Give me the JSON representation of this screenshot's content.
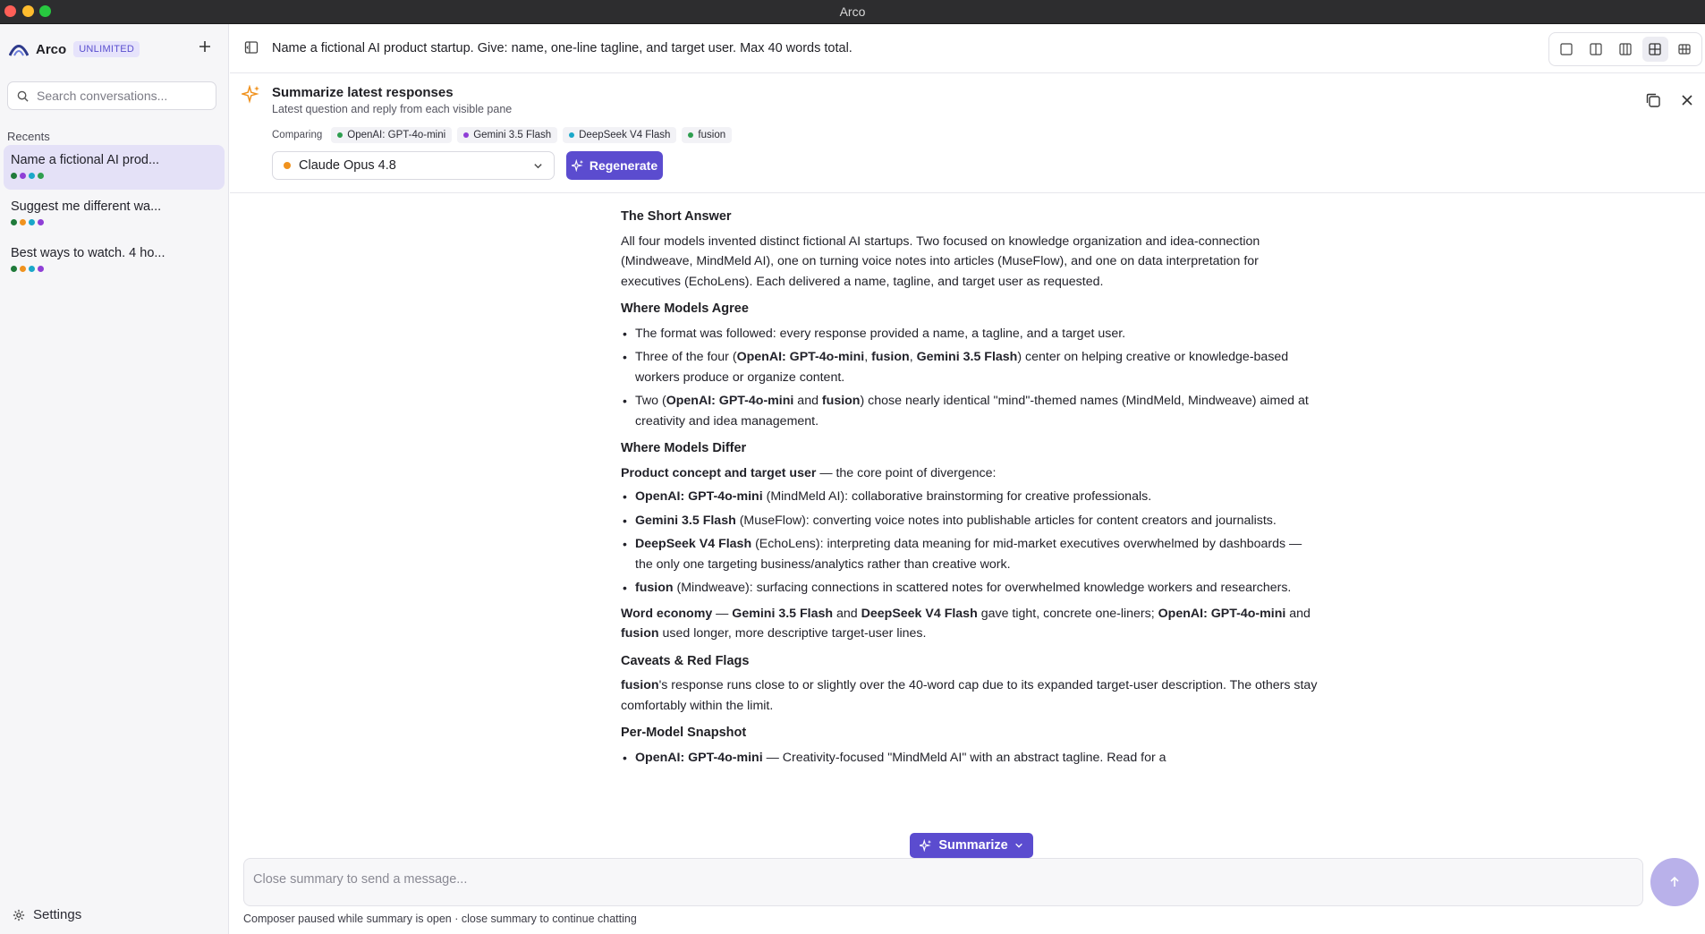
{
  "window": {
    "title": "Arco"
  },
  "sidebar": {
    "brand": "Arco",
    "badge": "UNLIMITED",
    "search_placeholder": "Search conversations...",
    "recents_label": "Recents",
    "conversations": [
      {
        "title": "Name a fictional AI prod...",
        "dots": [
          "#1f7a3a",
          "#8f3fd6",
          "#1aa7c9",
          "#2e9e4f"
        ]
      },
      {
        "title": "Suggest me different wa...",
        "dots": [
          "#1f7a3a",
          "#f0921e",
          "#1aa7c9",
          "#8f3fd6"
        ]
      },
      {
        "title": "Best ways to watch. 4 ho...",
        "dots": [
          "#1f7a3a",
          "#f0921e",
          "#1aa7c9",
          "#8f3fd6"
        ]
      }
    ],
    "settings_label": "Settings"
  },
  "header": {
    "question": "Name a fictional AI product startup. Give: name, one-line tagline, and target user. Max 40 words total."
  },
  "summary": {
    "title": "Summarize latest responses",
    "subtitle": "Latest question and reply from each visible pane",
    "comparing_label": "Comparing",
    "chips": [
      {
        "label": "OpenAI: GPT-4o-mini",
        "color": "#2e9e4f"
      },
      {
        "label": "Gemini 3.5 Flash",
        "color": "#8f3fd6"
      },
      {
        "label": "DeepSeek V4 Flash",
        "color": "#1aa7c9"
      },
      {
        "label": "fusion",
        "color": "#2e9e4f"
      }
    ],
    "model": "Claude Opus 4.8",
    "model_color": "#f0921e",
    "regenerate_label": "Regenerate"
  },
  "article": {
    "h_short": "The Short Answer",
    "short_p": "All four models invented distinct fictional AI startups. Two focused on knowledge organization and idea-connection (Mindweave, MindMeld AI), one on turning voice notes into articles (MuseFlow), and one on data interpretation for executives (EchoLens). Each delivered a name, tagline, and target user as requested.",
    "h_agree": "Where Models Agree",
    "agree1": "The format was followed: every response provided a name, a tagline, and a target user.",
    "agree2_a": "Three of the four (",
    "agree2_b1": "OpenAI: GPT-4o-mini",
    "agree2_c1": ", ",
    "agree2_b2": "fusion",
    "agree2_c2": ", ",
    "agree2_b3": "Gemini 3.5 Flash",
    "agree2_d": ") center on helping creative or knowledge-based workers produce or organize content.",
    "agree3_a": "Two (",
    "agree3_b1": "OpenAI: GPT-4o-mini",
    "agree3_c": " and ",
    "agree3_b2": "fusion",
    "agree3_d": ") chose nearly identical \"mind\"-themed names (MindMeld, Mindweave) aimed at creativity and idea management.",
    "h_differ": "Where Models Differ",
    "differ_lead_b": "Product concept and target user",
    "differ_lead_t": " — the core point of divergence:",
    "differ1_b": "OpenAI: GPT-4o-mini",
    "differ1_t": " (MindMeld AI): collaborative brainstorming for creative professionals.",
    "differ2_b": "Gemini 3.5 Flash",
    "differ2_t": " (MuseFlow): converting voice notes into publishable articles for content creators and journalists.",
    "differ3_b": "DeepSeek V4 Flash",
    "differ3_t": " (EchoLens): interpreting data meaning for mid-market executives overwhelmed by dashboards — the only one targeting business/analytics rather than creative work.",
    "differ4_b": "fusion",
    "differ4_t": " (Mindweave): surfacing connections in scattered notes for overwhelmed knowledge workers and researchers.",
    "word_b1": "Word economy",
    "word_t1": " — ",
    "word_b2": "Gemini 3.5 Flash",
    "word_t2": " and ",
    "word_b3": "DeepSeek V4 Flash",
    "word_t3": " gave tight, concrete one-liners; ",
    "word_b4": "OpenAI: GPT-4o-mini",
    "word_t4": " and ",
    "word_b5": "fusion",
    "word_t5": " used longer, more descriptive target-user lines.",
    "h_caveats": "Caveats & Red Flags",
    "caveat_b": "fusion",
    "caveat_t": "'s response runs close to or slightly over the 40-word cap due to its expanded target-user description. The others stay comfortably within the limit.",
    "h_snapshot": "Per-Model Snapshot",
    "snap1_b": "OpenAI: GPT-4o-mini",
    "snap1_t": " — Creativity-focused \"MindMeld AI\" with an abstract tagline. Read for a"
  },
  "summarize_pill": "Summarize",
  "composer": {
    "placeholder": "Close summary to send a message...",
    "note": "Composer paused while summary is open · close summary to continue chatting"
  },
  "icons": {
    "search": "search-icon",
    "plus": "plus-icon",
    "settings": "gear-icon",
    "sidebar_toggle": "sidebar-toggle-icon",
    "sparkle": "sparkle-icon",
    "copy": "copy-icon",
    "close": "close-icon",
    "chevron": "chevron-down-icon",
    "send": "arrow-up-icon"
  },
  "colors": {
    "accent": "#5b4ccf",
    "accent_light": "#e4e1f7"
  }
}
